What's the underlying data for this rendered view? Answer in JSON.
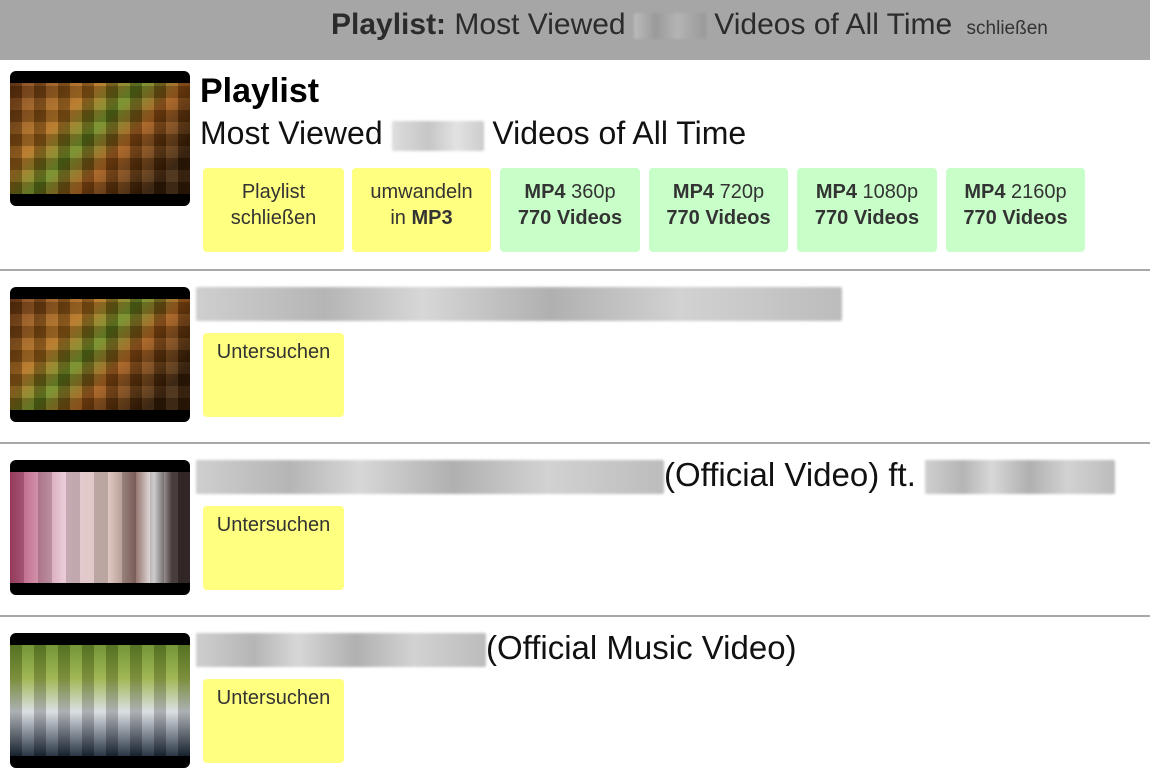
{
  "topbar": {
    "prefix": "Playlist:",
    "title_before": "Most Viewed",
    "title_after": "Videos of All Time",
    "close_label": "schließen"
  },
  "playlist": {
    "heading": "Playlist",
    "subtitle_before": "Most Viewed",
    "subtitle_after": "Videos of All Time",
    "buttons": [
      {
        "line1": "Playlist",
        "line2": "schließen"
      },
      {
        "line1": "umwandeln",
        "line2_prefix": "in",
        "line2_bold": "MP3"
      },
      {
        "format": "MP4",
        "quality": "360p",
        "count": "770 Videos"
      },
      {
        "format": "MP4",
        "quality": "720p",
        "count": "770 Videos"
      },
      {
        "format": "MP4",
        "quality": "1080p",
        "count": "770 Videos"
      },
      {
        "format": "MP4",
        "quality": "2160p",
        "count": "770 Videos"
      }
    ]
  },
  "videos": [
    {
      "title_suffix": "",
      "action": "Untersuchen"
    },
    {
      "title_suffix": "(Official Video) ft.",
      "action": "Untersuchen"
    },
    {
      "title_suffix": "(Official Music Video)",
      "action": "Untersuchen"
    }
  ],
  "colors": {
    "topbar": "#a6a6a6",
    "yellow_button": "#ffff80",
    "green_button": "#c8ffc8",
    "divider": "#a8a8a8"
  }
}
